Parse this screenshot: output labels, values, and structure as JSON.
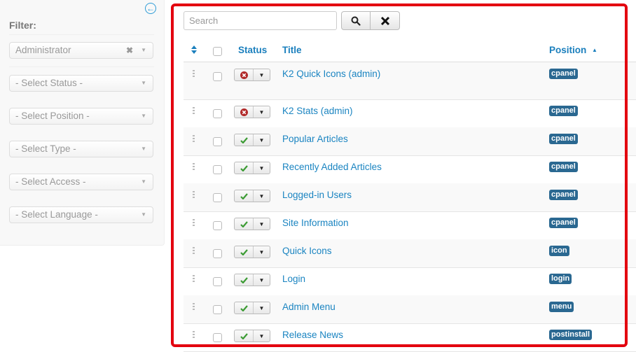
{
  "sidebar": {
    "filter_label": "Filter:",
    "collapse_icon": "arrow-left-circle-icon",
    "filters": [
      {
        "name": "client-filter",
        "value": "Administrator",
        "clearable": true
      },
      {
        "name": "status-filter",
        "value": "- Select Status -"
      },
      {
        "name": "position-filter",
        "value": "- Select Position -"
      },
      {
        "name": "type-filter",
        "value": "- Select Type -"
      },
      {
        "name": "access-filter",
        "value": "- Select Access -"
      },
      {
        "name": "language-filter",
        "value": "- Select Language -"
      }
    ]
  },
  "search": {
    "placeholder": "Search",
    "value": "",
    "search_icon": "search-icon",
    "clear_icon": "close-icon"
  },
  "table": {
    "headers": {
      "ordering_icon": "sort-icon",
      "status": "Status",
      "title": "Title",
      "position": "Position",
      "position_sort": "ascending"
    },
    "rows": [
      {
        "status": "unpublished",
        "title": "K2 Quick Icons (admin)",
        "position": "cpanel"
      },
      {
        "status": "unpublished",
        "title": "K2 Stats (admin)",
        "position": "cpanel"
      },
      {
        "status": "published",
        "title": "Popular Articles",
        "position": "cpanel"
      },
      {
        "status": "published",
        "title": "Recently Added Articles",
        "position": "cpanel"
      },
      {
        "status": "published",
        "title": "Logged-in Users",
        "position": "cpanel"
      },
      {
        "status": "published",
        "title": "Site Information",
        "position": "cpanel"
      },
      {
        "status": "published",
        "title": "Quick Icons",
        "position": "icon"
      },
      {
        "status": "published",
        "title": "Login",
        "position": "login"
      },
      {
        "status": "published",
        "title": "Admin Menu",
        "position": "menu"
      },
      {
        "status": "published",
        "title": "Release News",
        "position": "postinstall"
      }
    ]
  },
  "colors": {
    "link": "#1a84c1",
    "badge": "#2a6891",
    "highlight_frame": "#e3000f",
    "published": "#3b9b33",
    "unpublished": "#b12a2a"
  }
}
